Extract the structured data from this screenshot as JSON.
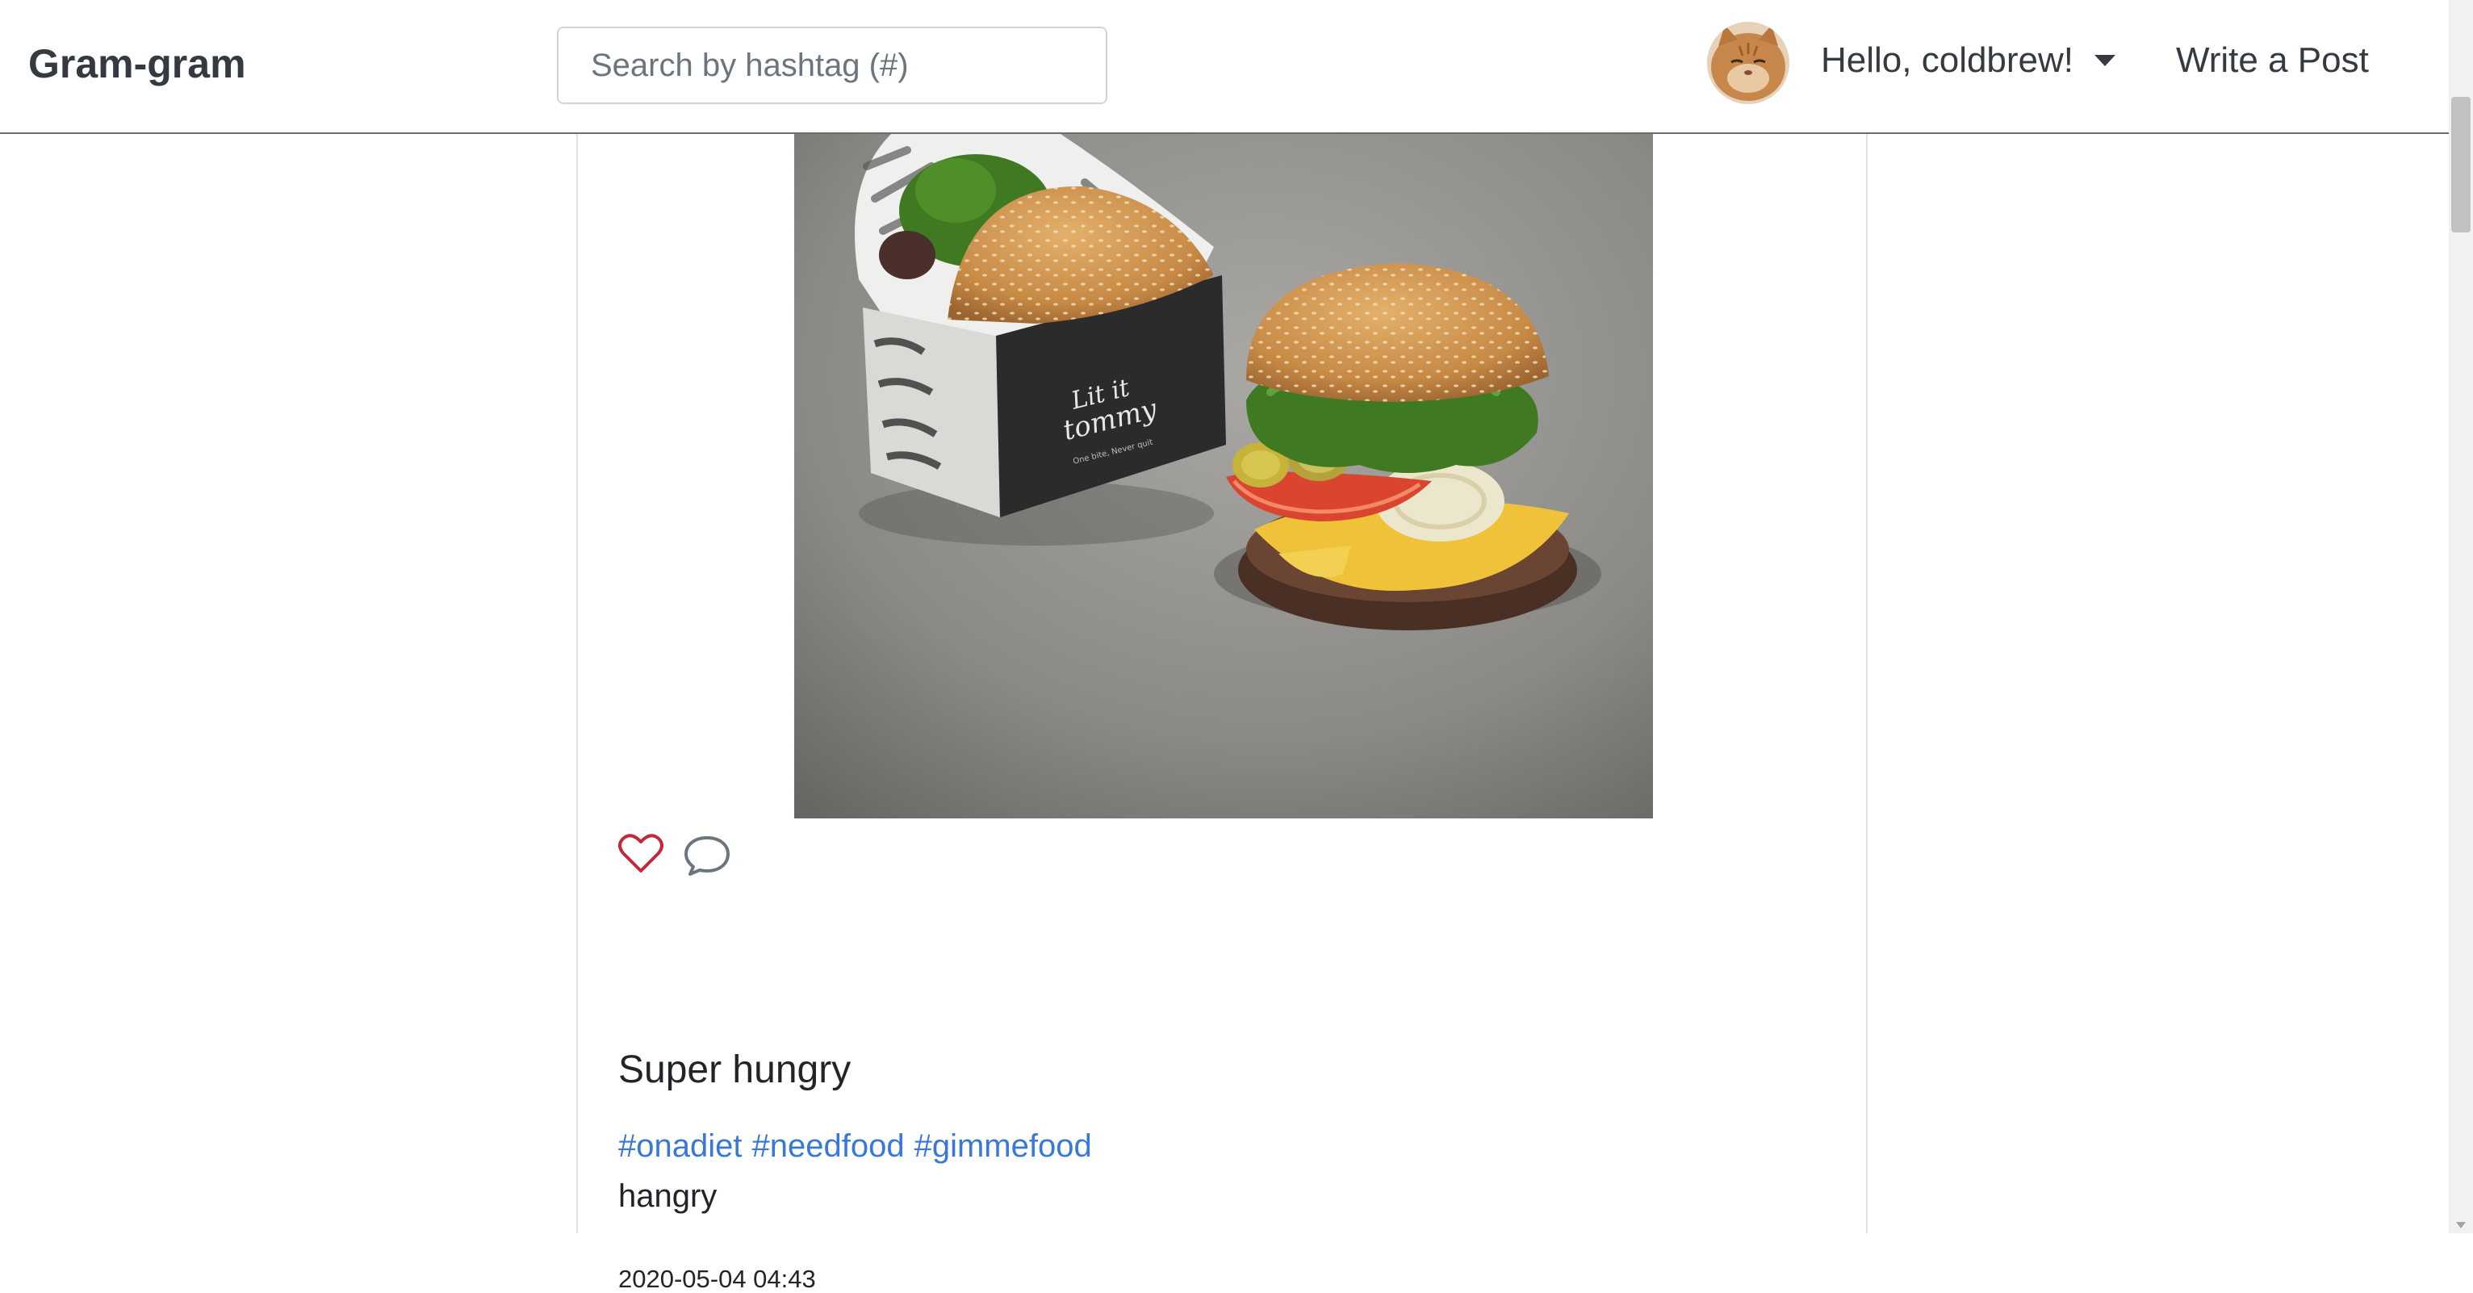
{
  "navbar": {
    "brand": "Gram-gram",
    "search_placeholder": "Search by hashtag (#)",
    "greeting": "Hello, coldbrew!",
    "write_post": "Write a Post"
  },
  "post": {
    "title": "Super hungry",
    "tags": [
      "#onadiet",
      "#needfood",
      "#gimmefood"
    ],
    "body": "hangry",
    "date": "2020-05-04 04:43",
    "box_text_line1": "Lit it",
    "box_text_line2": "tommy",
    "box_tagline": "One bite, Never quit"
  },
  "icons": {
    "like": "heart-outline-icon",
    "comment": "chat-bubble-icon",
    "like_color": "#c0283c",
    "comment_color": "#6c757d"
  },
  "colors": {
    "link": "#3a78d8",
    "text": "#212529",
    "brand": "#343a40"
  }
}
